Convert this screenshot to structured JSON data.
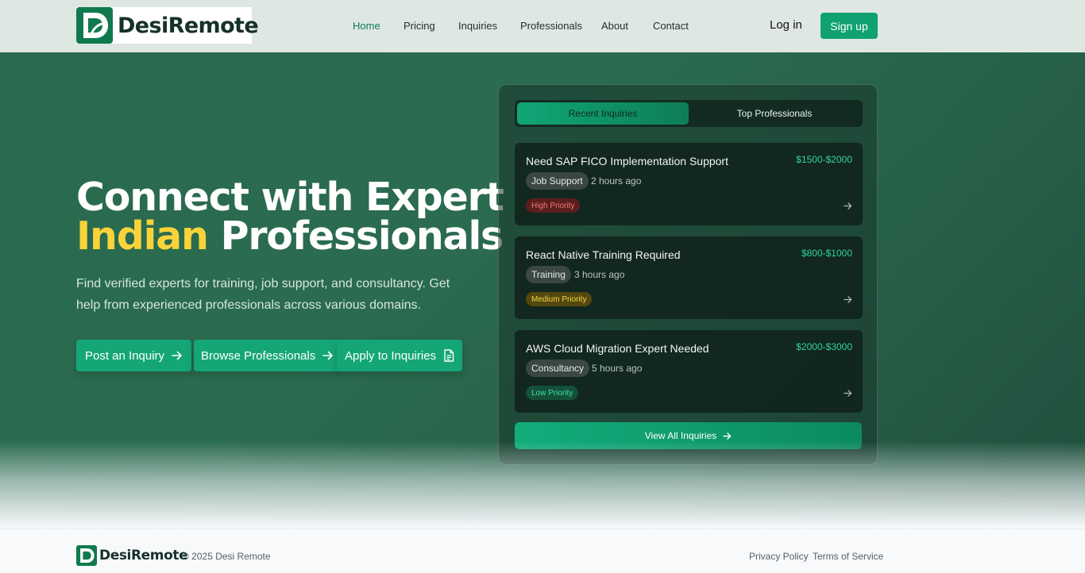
{
  "brand": {
    "name": "DesiRemote"
  },
  "nav": {
    "items": [
      {
        "label": "Home",
        "active": true
      },
      {
        "label": "Pricing",
        "active": false
      },
      {
        "label": "Inquiries",
        "active": false
      },
      {
        "label": "Professionals",
        "active": false
      },
      {
        "label": "About",
        "active": false
      },
      {
        "label": "Contact",
        "active": false
      }
    ],
    "login_label": "Log in",
    "signup_label": "Sign up"
  },
  "hero": {
    "headline_line1": "Connect with Expert",
    "headline_highlight": "Indian",
    "headline_rest": "Professionals",
    "subtext": "Find verified experts for training, job support, and consultancy. Get help from experienced professionals across various domains.",
    "buttons": [
      {
        "label": "Post an Inquiry",
        "icon": "arrow-right-icon"
      },
      {
        "label": "Browse Professionals",
        "icon": "arrow-right-icon"
      },
      {
        "label": "Apply to Inquiries",
        "icon": "document-icon"
      }
    ]
  },
  "panel": {
    "tabs": [
      {
        "label": "Recent Inquiries",
        "active": true
      },
      {
        "label": "Top Professionals",
        "active": false
      }
    ],
    "inquiries": [
      {
        "title": "Need SAP FICO Implementation Support",
        "price": "$1500-$2000",
        "type": "Job Support",
        "time": "2 hours ago",
        "priority": "High Priority",
        "level": "high"
      },
      {
        "title": "React Native Training Required",
        "price": "$800-$1000",
        "type": "Training",
        "time": "3 hours ago",
        "priority": "Medium Priority",
        "level": "medium"
      },
      {
        "title": "AWS Cloud Migration Expert Needed",
        "price": "$2000-$3000",
        "type": "Consultancy",
        "time": "5 hours ago",
        "priority": "Low Priority",
        "level": "low"
      }
    ],
    "view_all_label": "View All Inquiries"
  },
  "footer": {
    "brand": "DesiRemote",
    "copyright": "© 2025 Desi Remote",
    "links": [
      "Privacy Policy",
      "Terms of Service"
    ]
  },
  "colors": {
    "accent": "#10a173",
    "highlight": "#f8d33a",
    "hero_bg": "#2a6b4f"
  }
}
